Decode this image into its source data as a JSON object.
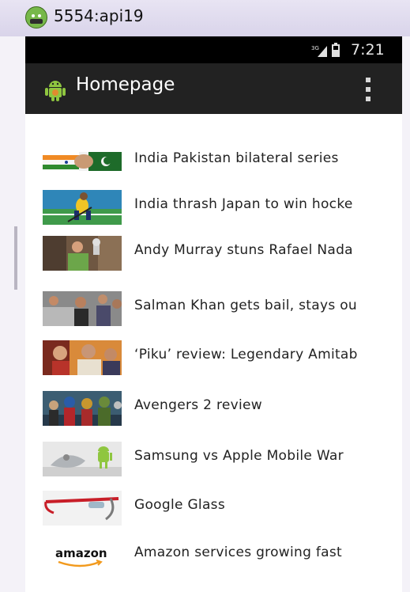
{
  "window": {
    "title": "5554:api19"
  },
  "status_bar": {
    "time": "7:21",
    "network": "3G"
  },
  "action_bar": {
    "title": "Homepage",
    "app_icon": "android-icon",
    "overflow_icon": "overflow-menu-icon"
  },
  "news": {
    "items": [
      {
        "headline": "India Pakistan bilateral series",
        "thumb": "india-pakistan-flag-handshake"
      },
      {
        "headline": "India thrash Japan to win hocke",
        "thumb": "hockey-player"
      },
      {
        "headline": "Andy Murray stuns Rafael Nada",
        "thumb": "andy-murray-trophy"
      },
      {
        "headline": "Salman Khan gets bail, stays ou",
        "thumb": "salman-khan-crowd"
      },
      {
        "headline": "‘Piku’ review: Legendary Amitab",
        "thumb": "piku-poster"
      },
      {
        "headline": "Avengers 2 review",
        "thumb": "avengers-poster"
      },
      {
        "headline": "Samsung vs Apple Mobile War",
        "thumb": "android-vs-apple"
      },
      {
        "headline": "Google Glass",
        "thumb": "google-glass"
      },
      {
        "headline": "Amazon services growing fast",
        "thumb": "amazon-logo"
      }
    ]
  },
  "colors": {
    "status_bar": "#000000",
    "action_bar": "#222222",
    "list_background": "#ffffff",
    "headline_text": "#222222"
  }
}
